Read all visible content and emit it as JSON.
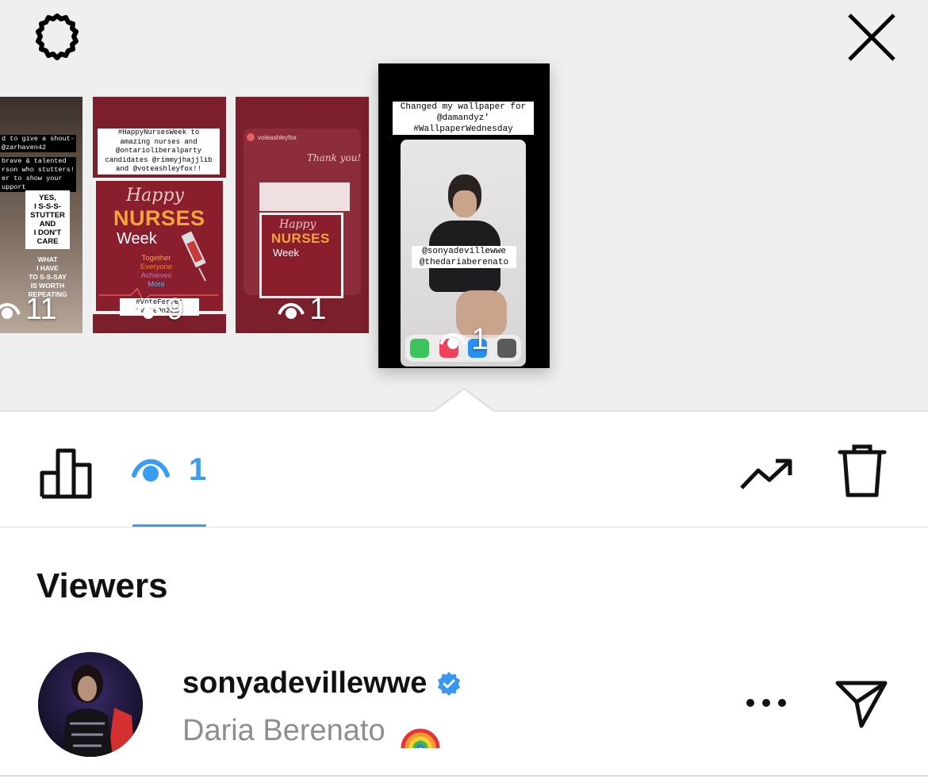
{
  "header": {
    "settings_icon": "gear-icon",
    "close_icon": "close-icon"
  },
  "stories": [
    {
      "lines": [
        "d to give a shout-",
        "@zarhaven42",
        "brave & talented",
        "rson who stutters!",
        "er to show your",
        "upport"
      ],
      "card_lines": [
        "YES,",
        "I S-S-S-",
        "STUTTER",
        "AND",
        "I DON'T",
        "CARE"
      ],
      "quote_lines": [
        "WHAT",
        "I HAVE",
        "TO S-S-SAY",
        "IS WORTH",
        "REPEATING"
      ],
      "views": "11"
    },
    {
      "lines": [
        "#HappyNursesWeek to",
        "amazing nurses and",
        "@ontarioliberalparty",
        "candidates @rimmyjhajjlib",
        "and @voteashleyfox!!"
      ],
      "happy": "Happy",
      "nurses": "NURSES",
      "week": "Week",
      "tagline": [
        "Together",
        "Everyone",
        "Achieves",
        "More"
      ],
      "footer": [
        "#VoteFerret",
        "#VoteOn2022"
      ],
      "views": "9"
    },
    {
      "account": "voteashleyfox",
      "thanks": "Thank you!",
      "happy": "Happy",
      "nurses": "NURSES",
      "week": "Week",
      "views": "1"
    },
    {
      "caption_lines": [
        "Changed my wallpaper for",
        "@damandyz'",
        "#WallpaperWednesday"
      ],
      "tags": [
        "@sonyadevillewwe",
        "@thedariaberenato"
      ],
      "views": "1"
    }
  ],
  "tabs": {
    "insights_icon": "bar-chart-icon",
    "viewers_count": "1",
    "trend_icon": "trending-up-icon",
    "delete_icon": "trash-icon"
  },
  "viewers": {
    "heading": "Viewers",
    "list": [
      {
        "username": "sonyadevillewwe",
        "verified": true,
        "full_name": "Daria Berenato",
        "emoji": "🌈",
        "more_icon": "more-icon",
        "send_icon": "send-icon"
      }
    ]
  },
  "colors": {
    "accent": "#3a9df2",
    "story_bg": "#7a1f2b",
    "verified": "#3897f0"
  }
}
